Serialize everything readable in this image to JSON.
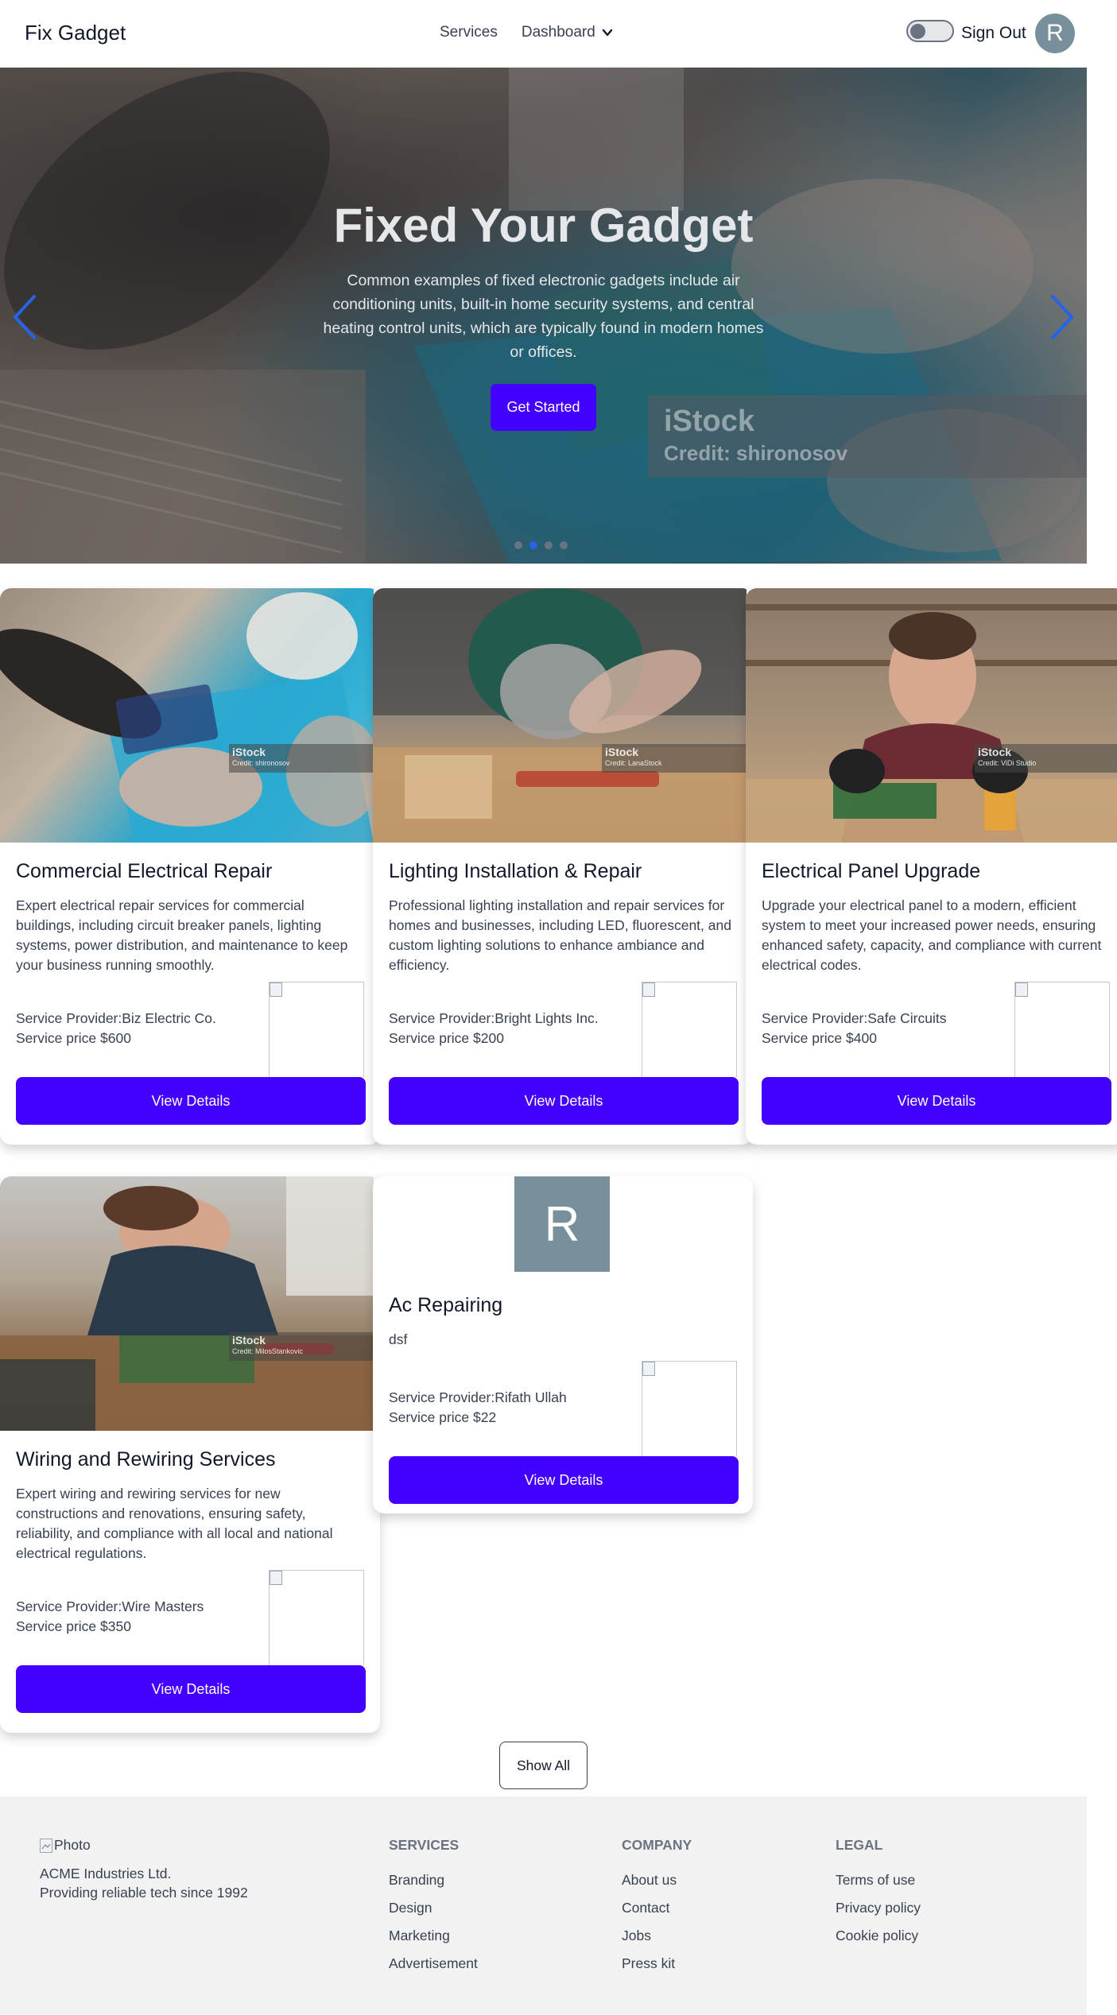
{
  "navbar": {
    "brand": "Fix Gadget",
    "links": {
      "services": "Services",
      "dashboard": "Dashboard"
    },
    "sign_out": "Sign Out",
    "avatar_initial": "R"
  },
  "hero": {
    "title": "Fixed Your Gadget",
    "text": "Common examples of fixed electronic gadgets include air conditioning units, built-in home security systems, and central heating control units, which are typically found in modern homes or offices.",
    "button": "Get Started",
    "watermark_brand": "iStock",
    "watermark_credit": "Credit: shironosov",
    "slides_count": 4,
    "active_slide": 2
  },
  "cards": [
    {
      "title": "Commercial Electrical Repair",
      "description": "Expert electrical repair services for commercial buildings, including circuit breaker panels, lighting systems, power distribution, and maintenance to keep your business running smoothly.",
      "provider": "Service Provider:Biz Electric Co.",
      "price": "Service price $600",
      "button": "View Details",
      "watermark_brand": "iStock",
      "watermark_credit": "Credit: shironosov"
    },
    {
      "title": "Lighting Installation & Repair",
      "description": "Professional lighting installation and repair services for homes and businesses, including LED, fluorescent, and custom lighting solutions to enhance ambiance and efficiency.",
      "provider": "Service Provider:Bright Lights Inc.",
      "price": "Service price $200",
      "button": "View Details",
      "watermark_brand": "iStock",
      "watermark_credit": "Credit: LanaStock"
    },
    {
      "title": "Electrical Panel Upgrade",
      "description": "Upgrade your electrical panel to a modern, efficient system to meet your increased power needs, ensuring enhanced safety, capacity, and compliance with current electrical codes.",
      "provider": "Service Provider:Safe Circuits",
      "price": "Service price $400",
      "button": "View Details",
      "watermark_brand": "iStock",
      "watermark_credit": "Credit: ViDi Studio"
    },
    {
      "title": "Wiring and Rewiring Services",
      "description": "Expert wiring and rewiring services for new constructions and renovations, ensuring safety, reliability, and compliance with all local and national electrical regulations.",
      "provider": "Service Provider:Wire Masters",
      "price": "Service price $350",
      "button": "View Details",
      "watermark_brand": "iStock",
      "watermark_credit": "Credit: MilosStankovic"
    },
    {
      "title": "Ac Repairing",
      "description": "dsf",
      "provider": "Service Provider:Rifath Ullah",
      "price": "Service price $22",
      "button": "View Details",
      "avatar_initial": "R"
    }
  ],
  "show_all": "Show All",
  "footer": {
    "logo_alt": "Photo",
    "company": "ACME Industries Ltd.",
    "tagline": "Providing reliable tech since 1992",
    "services": {
      "heading": "SERVICES",
      "links": [
        "Branding",
        "Design",
        "Marketing",
        "Advertisement"
      ]
    },
    "company_col": {
      "heading": "COMPANY",
      "links": [
        "About us",
        "Contact",
        "Jobs",
        "Press kit"
      ]
    },
    "legal": {
      "heading": "LEGAL",
      "links": [
        "Terms of use",
        "Privacy policy",
        "Cookie policy"
      ]
    }
  },
  "colors": {
    "primary": "#4400ff",
    "avatar": "#78909c",
    "footer_bg": "#f2f2f2",
    "carousel_arrow": "#2563eb"
  }
}
